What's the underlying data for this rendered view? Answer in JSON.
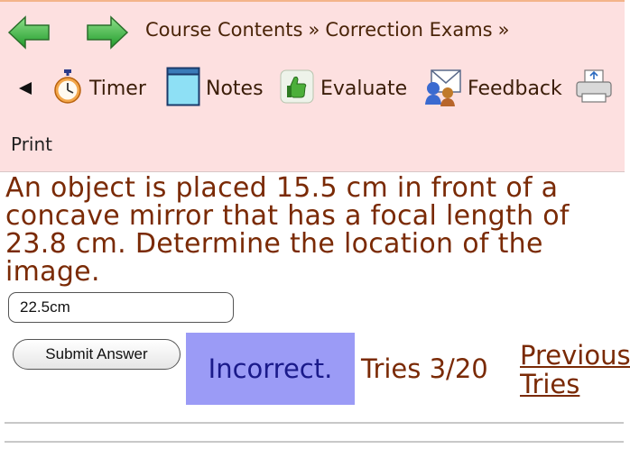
{
  "nav": {
    "breadcrumb": {
      "course_contents": "Course Contents",
      "separator": "»",
      "correction_exams": "Correction Exams",
      "trailing_separator": "»"
    },
    "icons": {
      "back": "green-left-arrow-icon",
      "forward": "green-right-arrow-icon",
      "timer": "stopwatch-icon",
      "notes": "notepad-icon",
      "evaluate": "thumbs-up-icon",
      "feedback": "feedback-icon",
      "print": "printer-icon"
    },
    "tools": {
      "timer": "Timer",
      "notes": "Notes",
      "evaluate": "Evaluate",
      "feedback": "Feedback",
      "print": "Print"
    }
  },
  "question": {
    "text": "An object is placed 15.5 cm in front of a concave mirror that has a focal length of 23.8 cm. Determine the location of the image."
  },
  "answer": {
    "value": "22.5cm",
    "submit_label": "Submit Answer"
  },
  "result": {
    "status": "Incorrect.",
    "tries": "Tries 3/20",
    "previous_tries_line1": "Previous",
    "previous_tries_line2": "Tries"
  },
  "colors": {
    "nav_background": "#fde0e0",
    "text_brown": "#7a2a05",
    "incorrect_background": "#9b9bf6",
    "incorrect_text": "#1a1a8a",
    "arrow_green": "#3cb84a"
  }
}
